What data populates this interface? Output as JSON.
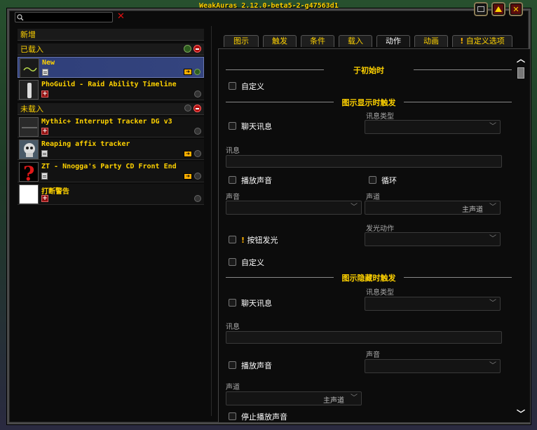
{
  "window": {
    "title": "WeakAuras 2.12.0-beta5-2-g47563d1"
  },
  "search": {
    "placeholder": ""
  },
  "sidebar": {
    "new_label": "新增",
    "loaded_label": "已载入",
    "unloaded_label": "未载入",
    "loaded": [
      {
        "name": "New"
      },
      {
        "name": "PhoGuild - Raid Ability Timeline"
      }
    ],
    "unloaded": [
      {
        "name": "Mythic+ Interrupt Tracker DG v3"
      },
      {
        "name": "Reaping affix tracker"
      },
      {
        "name": "ZT - Nnogga's Party CD Front End"
      },
      {
        "name": "打断警告"
      }
    ]
  },
  "tabs": [
    {
      "label": "图示"
    },
    {
      "label": "触发"
    },
    {
      "label": "条件"
    },
    {
      "label": "载入"
    },
    {
      "label": "动作"
    },
    {
      "label": "动画"
    },
    {
      "label": "自定义选项"
    }
  ],
  "actions": {
    "on_init": {
      "title": "于初始时",
      "custom_label": "自定义"
    },
    "on_show": {
      "title": "图示显示时触发",
      "chat_label": "聊天讯息",
      "msg_type_label": "讯息类型",
      "msg_label": "讯息",
      "play_sound_label": "播放声音",
      "loop_label": "循环",
      "sound_label": "声音",
      "channel_label": "声道",
      "channel_value": "主声道",
      "glow_action_label": "发光动作",
      "button_glow_label": "按钮发光",
      "custom_label": "自定义"
    },
    "on_hide": {
      "title": "图示隐藏时触发",
      "chat_label": "聊天讯息",
      "msg_type_label": "讯息类型",
      "msg_label": "讯息",
      "play_sound_label": "播放声音",
      "sound_label": "声音",
      "channel_label": "声道",
      "channel_value": "主声道",
      "stop_sound_label": "停止播放声音"
    }
  }
}
